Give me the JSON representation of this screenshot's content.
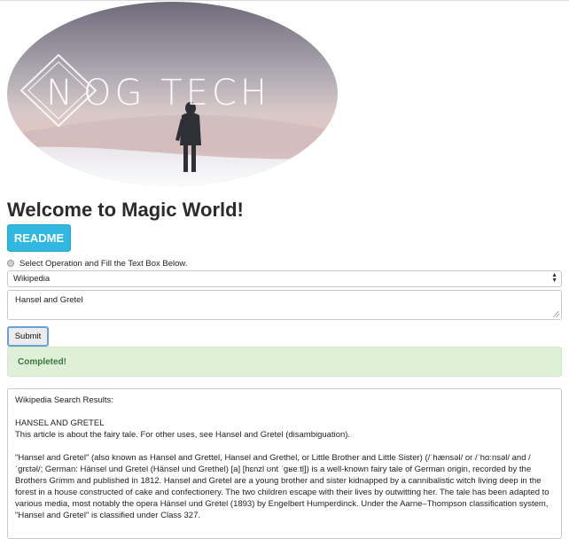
{
  "banner": {
    "brand_letter": "N",
    "brand_rest": "OG TECH"
  },
  "page": {
    "title": "Welcome to Magic World!"
  },
  "buttons": {
    "readme_label": "README",
    "submit_label": "Submit"
  },
  "operation": {
    "instruction": "Select Operation and Fill the Text Box Below.",
    "selected": "Wikipedia"
  },
  "query": {
    "value": "Hansel and Gretel"
  },
  "status": {
    "message": "Completed!"
  },
  "results": {
    "heading": "Wikipedia Search Results:",
    "article_title": "HANSEL AND GRETEL",
    "hatnote": "This article is about the fairy tale. For other uses, see Hansel and Gretel (disambiguation).",
    "paragraph": "\"Hansel and Gretel\" (also known as Hansel and Grettel, Hansel and Grethel, or Little Brother and Little Sister) (/ˈhænsəl/ or /ˈhɑːnsəl/ and /ˈɡrɛtəl/; German: Hänsel und Gretel (Hänsel und Grethel) [a] [hɛnzl ʊnt ˈɡʁeːtl̩]) is a well-known fairy tale of German origin, recorded by the Brothers Grimm and published in 1812. Hansel and Gretel are a young brother and sister kidnapped by a cannibalistic witch living deep in the forest in a house constructed of cake and confectionery. The two children escape with their lives by outwitting her. The tale has been adapted to various media, most notably the opera Hänsel und Gretel (1893) by Engelbert Humperdinck. Under the Aarne–Thompson classification system, \"Hansel and Gretel\" is classified under Class 327."
  },
  "colors": {
    "readme_bg": "#31b8e2",
    "success_bg": "#dff0d8",
    "success_text": "#3c763d"
  }
}
